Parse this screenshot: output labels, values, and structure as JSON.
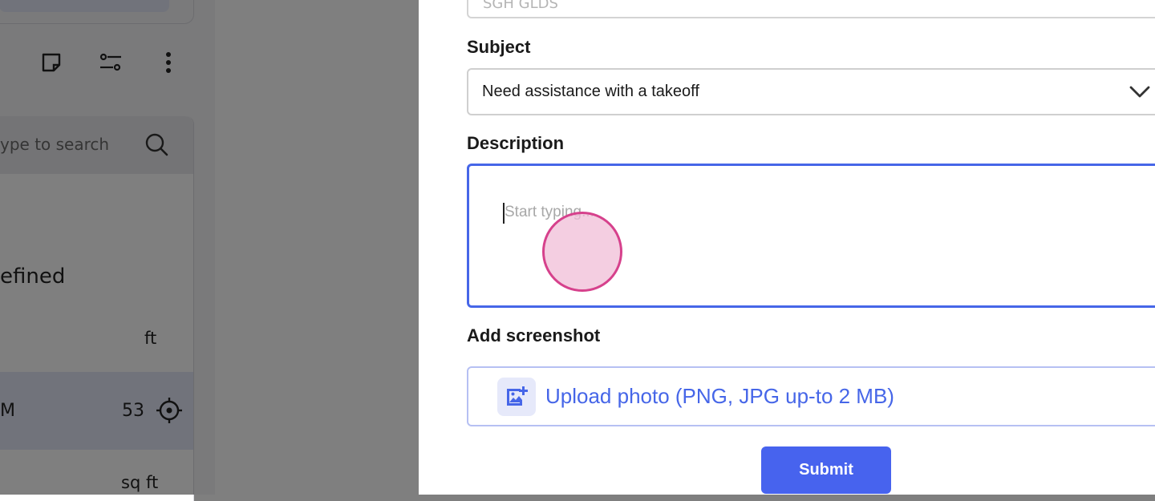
{
  "background": {
    "search_placeholder": "ype to search",
    "group_heading": "efined",
    "unit_length": "ft",
    "selected_row": {
      "label": "M",
      "value": "53"
    },
    "unit_area": "sq ft"
  },
  "modal": {
    "previous_field_value": "SGH GLDS",
    "subject": {
      "label": "Subject",
      "value": "Need assistance with a takeoff"
    },
    "description": {
      "label": "Description",
      "placeholder": "Start typing..."
    },
    "screenshot": {
      "label": "Add screenshot",
      "upload_text": "Upload photo (PNG, JPG up-to 2 MB)"
    },
    "submit_label": "Submit"
  },
  "colors": {
    "accent": "#4666e8",
    "submit_bg": "#4763ee",
    "overlay": "rgba(0,0,0,0.5)",
    "click_indicator": "#d6418c"
  },
  "icons": [
    "note-icon",
    "filter-icon",
    "more-vertical-icon",
    "search-icon",
    "target-icon",
    "chevron-down-icon",
    "image-add-icon"
  ]
}
